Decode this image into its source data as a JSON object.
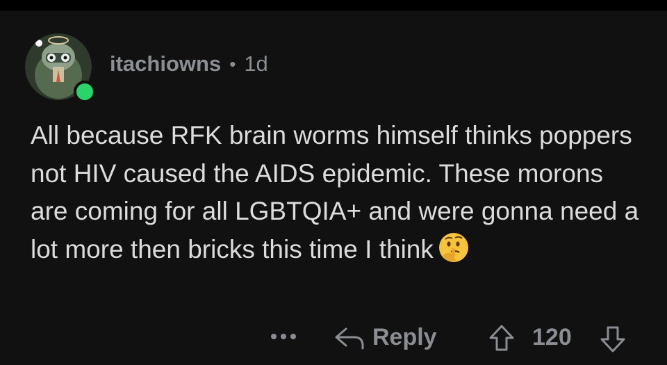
{
  "comment": {
    "author": "itachiowns",
    "separator": "•",
    "age": "1d",
    "body": "All because RFK brain worms himself thinks poppers not HIV caused the AIDS epidemic.  These morons are coming for all LGBTQIA+ and were gonna need a lot more then bricks this time I think",
    "emoji": "thinking-face",
    "avatar_icon": "robot-avatar-icon",
    "online_color": "#2bd36b"
  },
  "actions": {
    "more": "•••",
    "reply_label": "Reply",
    "score": "120"
  }
}
